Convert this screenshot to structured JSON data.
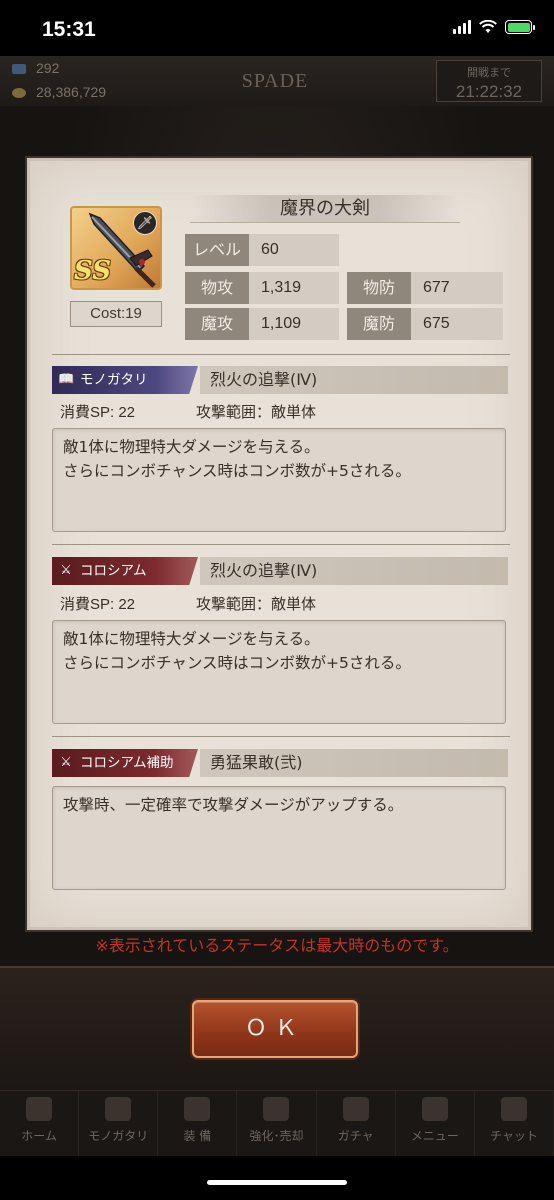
{
  "status_bar": {
    "time": "15:31"
  },
  "header": {
    "resource1": "292",
    "resource2": "28,386,729",
    "title": "SPADE",
    "timer_label": "開戦まで",
    "timer_value": "21:22:32"
  },
  "weapon": {
    "name": "魔界の大剣",
    "rank": "SS",
    "cost_text": "Cost:19",
    "icon": "sword-icon",
    "stats": {
      "level_label": "レベル",
      "level_value": "60",
      "patk_label": "物攻",
      "patk_value": "1,319",
      "pdef_label": "物防",
      "pdef_value": "677",
      "matk_label": "魔攻",
      "matk_value": "1,109",
      "mdef_label": "魔防",
      "mdef_value": "675"
    }
  },
  "skills": [
    {
      "tag": "モノガタリ",
      "tag_icon": "book-icon",
      "name": "烈火の追撃(Ⅳ)",
      "sp_text": "消費SP: 22",
      "range_text": "攻撃範囲：敵単体",
      "desc_line1": "敵1体に物理特大ダメージを与える。",
      "desc_line2": "さらにコンボチャンス時はコンボ数が+5される。"
    },
    {
      "tag": "コロシアム",
      "tag_icon": "crossed-swords-icon",
      "name": "烈火の追撃(Ⅳ)",
      "sp_text": "消費SP: 22",
      "range_text": "攻撃範囲：敵単体",
      "desc_line1": "敵1体に物理特大ダメージを与える。",
      "desc_line2": "さらにコンボチャンス時はコンボ数が+5される。"
    },
    {
      "tag": "コロシアム補助",
      "tag_icon": "support-icon",
      "name": "勇猛果敢(弐)",
      "desc_line1": "攻撃時、一定確率で攻撃ダメージがアップする。"
    }
  ],
  "notice": "※表示されているステータスは最大時のものです。",
  "ok_label": "ＯＫ",
  "tabs": [
    "ホーム",
    "モノガタリ",
    "装 備",
    "強化･売却",
    "ガチャ",
    "メニュー",
    "チャット"
  ]
}
